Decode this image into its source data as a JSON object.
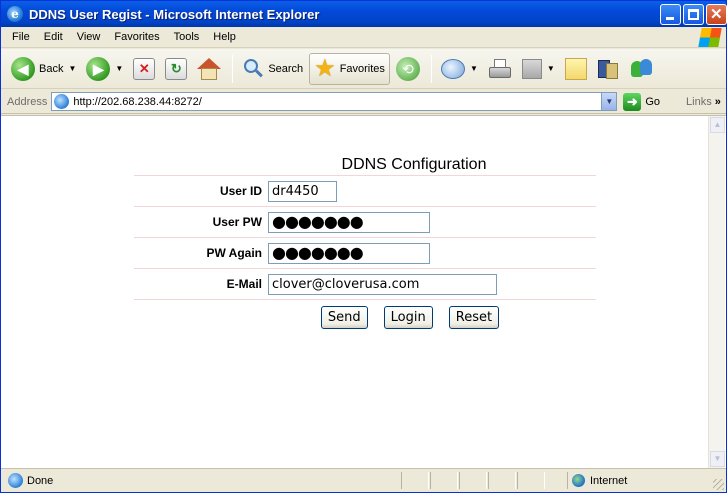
{
  "window": {
    "title": "DDNS User Regist - Microsoft Internet Explorer"
  },
  "menu": [
    "File",
    "Edit",
    "View",
    "Favorites",
    "Tools",
    "Help"
  ],
  "toolbar": {
    "back_label": "Back",
    "search_label": "Search",
    "favorites_label": "Favorites"
  },
  "address": {
    "label": "Address",
    "url": "http://202.68.238.44:8272/",
    "go_label": "Go",
    "links_label": "Links",
    "links_more": "»"
  },
  "form": {
    "title": "DDNS Configuration",
    "fields": [
      {
        "label": "User ID",
        "value": "dr4450",
        "type": "text"
      },
      {
        "label": "User PW",
        "value": "●●●●●●●",
        "type": "password"
      },
      {
        "label": "PW Again",
        "value": "●●●●●●●",
        "type": "password"
      },
      {
        "label": "E-Mail",
        "value": "clover@cloverusa.com",
        "type": "text"
      }
    ],
    "buttons": {
      "send": "Send",
      "login": "Login",
      "reset": "Reset"
    }
  },
  "status": {
    "text": "Done",
    "zone": "Internet"
  },
  "icons": {
    "title": "ie-logo-icon",
    "back": "back-arrow-icon",
    "forward": "forward-arrow-icon",
    "stop": "stop-icon",
    "refresh": "refresh-icon",
    "home": "home-icon",
    "search": "search-icon",
    "favorites": "star-icon",
    "history": "history-icon",
    "mail": "mail-icon",
    "print": "print-icon",
    "zone": "globe-icon"
  },
  "colors": {
    "titlebar": "#0348d8",
    "form_separator": "#f2d6d6",
    "field_border": "#7f9db9"
  }
}
